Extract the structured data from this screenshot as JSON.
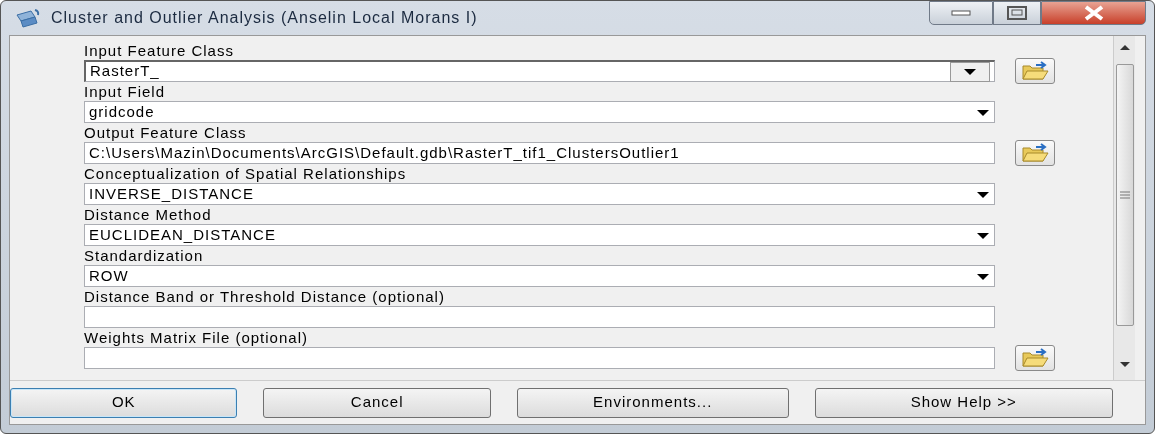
{
  "window": {
    "title": "Cluster and Outlier Analysis (Anselin Local Morans I)"
  },
  "parameters": [
    {
      "kind": "combo_browse",
      "label": "Input Feature Class",
      "value": "RasterT_"
    },
    {
      "kind": "dropdown",
      "label": "Input Field",
      "value": "gridcode"
    },
    {
      "kind": "text_browse",
      "label": "Output Feature Class",
      "value": "C:\\Users\\Mazin\\Documents\\ArcGIS\\Default.gdb\\RasterT_tif1_ClustersOutlier1"
    },
    {
      "kind": "dropdown",
      "label": "Conceptualization of Spatial Relationships",
      "value": "INVERSE_DISTANCE"
    },
    {
      "kind": "dropdown",
      "label": "Distance Method",
      "value": "EUCLIDEAN_DISTANCE"
    },
    {
      "kind": "dropdown",
      "label": "Standardization",
      "value": "ROW"
    },
    {
      "kind": "text",
      "label": "Distance Band or Threshold Distance (optional)"
    },
    {
      "kind": "text_browse",
      "label": "Weights Matrix File (optional)"
    }
  ],
  "buttons": [
    {
      "label": "OK",
      "default": true
    },
    {
      "label": "Cancel",
      "default": false
    },
    {
      "label": "Environments...",
      "default": false
    },
    {
      "label": "Show Help >>",
      "default": false
    }
  ]
}
